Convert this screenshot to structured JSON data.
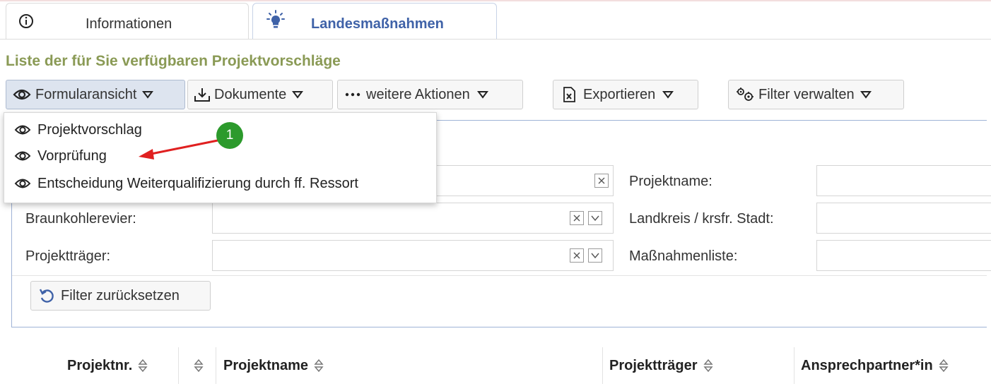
{
  "tabs": [
    {
      "label": "Informationen",
      "icon": "info-icon"
    },
    {
      "label": "Landesmaßnahmen",
      "icon": "lightbulb-icon",
      "active": true
    }
  ],
  "heading": "Liste der für Sie verfügbaren Projektvorschläge",
  "toolbar": {
    "formularansicht": "Formularansicht",
    "dokumente": "Dokumente",
    "weitere_aktionen": "weitere Aktionen",
    "exportieren": "Exportieren",
    "filter_verwalten": "Filter verwalten"
  },
  "dropdown_menu": {
    "items": [
      "Projektvorschlag",
      "Vorprüfung",
      "Entscheidung Weiterqualifizierung durch ff. Ressort"
    ]
  },
  "filters": {
    "left": [
      "Braunkohlerevier:",
      "Projektträger:"
    ],
    "right": [
      "Projektname:",
      "Landkreis / krsfr. Stadt:",
      "Maßnahmenliste:"
    ],
    "reset": "Filter zurücksetzen"
  },
  "table": {
    "columns": [
      "Projektnr.",
      "Projektname",
      "Projektträger",
      "Ansprechpartner*in"
    ]
  },
  "annotation": {
    "badge": "1"
  },
  "colors": {
    "accent": "#3f62a8",
    "heading": "#8a9a55",
    "badge": "#2c9a2c",
    "arrow": "#e02020"
  }
}
